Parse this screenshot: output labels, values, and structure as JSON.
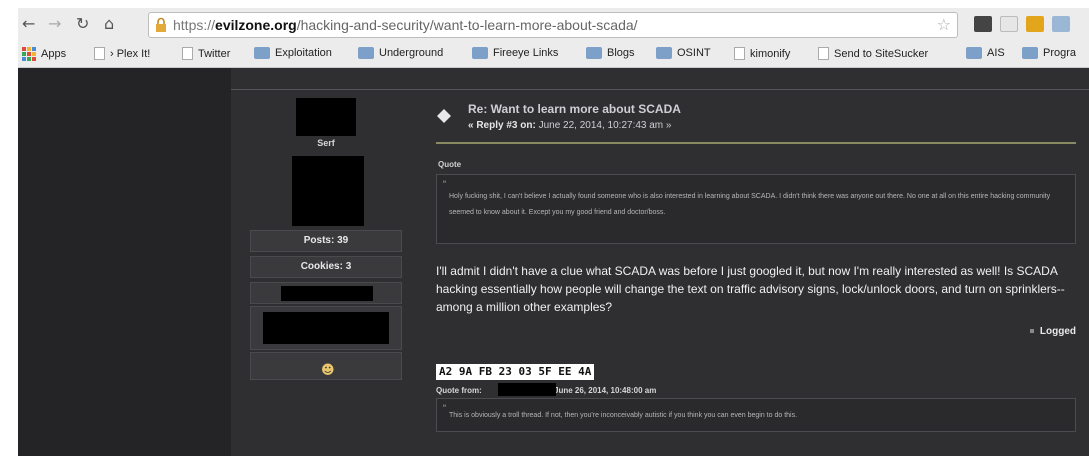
{
  "browser": {
    "url_protocol": "https://",
    "url_host": "evilzone.org",
    "url_path": "/hacking-and-security/want-to-learn-more-about-scada/",
    "bookmarks": [
      {
        "label": "Apps",
        "kind": "apps"
      },
      {
        "label": "› Plex It!",
        "kind": "page"
      },
      {
        "label": "Twitter",
        "kind": "page"
      },
      {
        "label": "Exploitation",
        "kind": "folder"
      },
      {
        "label": "Underground",
        "kind": "folder"
      },
      {
        "label": "Fireeye Links",
        "kind": "folder"
      },
      {
        "label": "Blogs",
        "kind": "folder"
      },
      {
        "label": "OSINT",
        "kind": "folder"
      },
      {
        "label": "kimonify",
        "kind": "page"
      },
      {
        "label": "Send to SiteSucker",
        "kind": "page"
      },
      {
        "label": "AIS",
        "kind": "folder"
      },
      {
        "label": "Progra",
        "kind": "folder"
      }
    ]
  },
  "poster": {
    "rank": "Serf",
    "posts": "Posts: 39",
    "cookies": "Cookies: 3"
  },
  "post": {
    "title": "Re: Want to learn more about SCADA",
    "meta_prefix": "« Reply #3 on:",
    "meta_date": "June 22, 2014, 10:27:43 am »",
    "quote_label": "Quote",
    "quote_text": "Holy fucking shit, I can't believe I actually found someone who is also interested in learning about SCADA. I didn't think there was anyone out there. No one at all on this entire hacking community seemed to know about it. Except you my good friend and doctor/boss.",
    "body": "I'll admit I didn't have a clue what SCADA was before I just googled it, but now I'm really interested as well! Is SCADA hacking essentially how people will change the text on traffic advisory signs, lock/unlock doors, and turn on sprinklers-- among a million other examples?",
    "logged": "Logged"
  },
  "signature": {
    "hex": "A2 9A FB 23 03 5F EE 4A",
    "quote_from": "Quote from:",
    "quote_date": "on June 26, 2014, 10:48:00 am",
    "quote_text": "This is obviously a troll thread. If not, then you're inconceivably autistic if you think you can even begin to do this."
  },
  "colors": {
    "page_bg": "#2f2f31",
    "sidebar_bg": "#242426",
    "accent_line": "#8a8a62",
    "redaction": "#000000"
  }
}
